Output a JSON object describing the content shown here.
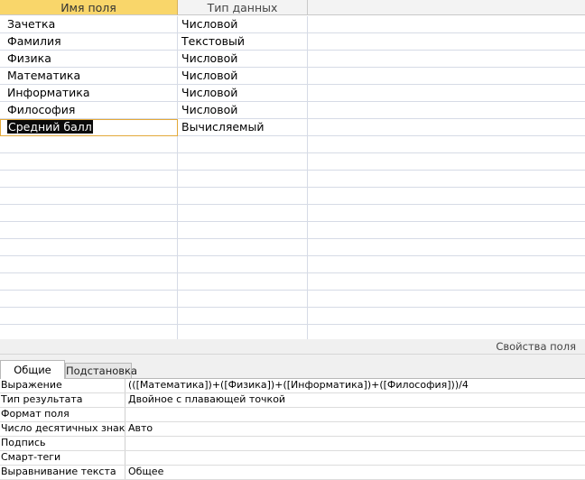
{
  "grid": {
    "headers": {
      "field_name": "Имя поля",
      "data_type": "Тип данных",
      "description": ""
    },
    "rows": [
      {
        "name": "Зачетка",
        "type": "Числовой",
        "description": ""
      },
      {
        "name": "Фамилия",
        "type": "Текстовый",
        "description": ""
      },
      {
        "name": "Физика",
        "type": "Числовой",
        "description": ""
      },
      {
        "name": "Математика",
        "type": "Числовой",
        "description": ""
      },
      {
        "name": "Информатика",
        "type": "Числовой",
        "description": ""
      },
      {
        "name": "Философия",
        "type": "Числовой",
        "description": ""
      },
      {
        "name": "Средний балл",
        "type": "Вычисляемый",
        "description": ""
      }
    ],
    "selected_row": 6
  },
  "properties": {
    "title": "Свойства поля",
    "tabs": [
      {
        "label": "Общие",
        "active": true
      },
      {
        "label": "Подстановка",
        "active": false
      }
    ],
    "items": [
      {
        "label": "Выражение",
        "value": "(([Математика])+([Физика])+([Информатика])+([Философия]))/4"
      },
      {
        "label": "Тип результата",
        "value": "Двойное с плавающей точкой"
      },
      {
        "label": "Формат поля",
        "value": ""
      },
      {
        "label": "Число десятичных знаков",
        "value": "Авто"
      },
      {
        "label": "Подпись",
        "value": ""
      },
      {
        "label": "Смарт-теги",
        "value": ""
      },
      {
        "label": "Выравнивание текста",
        "value": "Общее"
      }
    ]
  },
  "colors": {
    "header_active": "#f9d66a",
    "header_inactive": "#f3f3f3",
    "grid_line": "#d6dbe6",
    "selection_outline": "#e3a93a",
    "pane_background": "#f0f0f0"
  }
}
